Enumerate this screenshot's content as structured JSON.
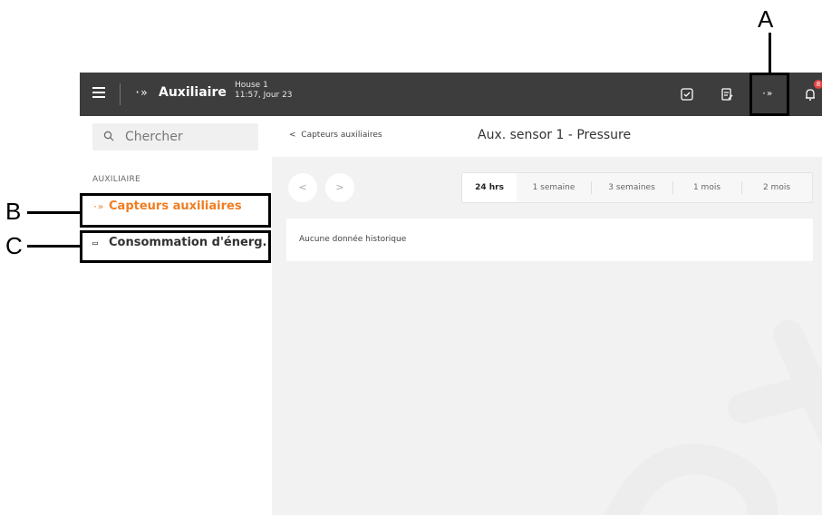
{
  "topbar": {
    "app_icon": "wireless-sensor-icon",
    "app_icon_glyph": "·»",
    "app_title": "Auxiliaire",
    "house_name": "House 1",
    "time_day": "11:57, Jour 23",
    "icons": [
      "inbox-icon",
      "document-edit-icon",
      "wireless-sensor-icon",
      "bell-icon"
    ],
    "aux_glyph": "·»",
    "notification_count": "8"
  },
  "sidebar": {
    "search_placeholder": "Chercher",
    "section_label": "AUXILIAIRE",
    "items": [
      {
        "label": "Capteurs auxiliaires",
        "icon": "wireless-sensor-icon",
        "glyph": "·»",
        "active": true
      },
      {
        "label": "Consommation d'énerg..",
        "icon": "folder-icon",
        "glyph": "▭",
        "active": false
      }
    ]
  },
  "main": {
    "back_label": "Capteurs auxiliaires",
    "back_glyph": "<",
    "title": "Aux. sensor 1 - Pressure",
    "prev_glyph": "<",
    "next_glyph": ">",
    "ranges": [
      "24 hrs",
      "1 semaine",
      "3 semaines",
      "1 mois",
      "2 mois"
    ],
    "selected_range": "24 hrs",
    "history_text": "Aucune donnée historique"
  },
  "annotations": {
    "a": "A",
    "b": "B",
    "c": "C"
  },
  "colors": {
    "topbar": "#3d3d3d",
    "accent": "#ef7d22",
    "badge": "#e64545",
    "main_bg": "#f2f2f2"
  }
}
